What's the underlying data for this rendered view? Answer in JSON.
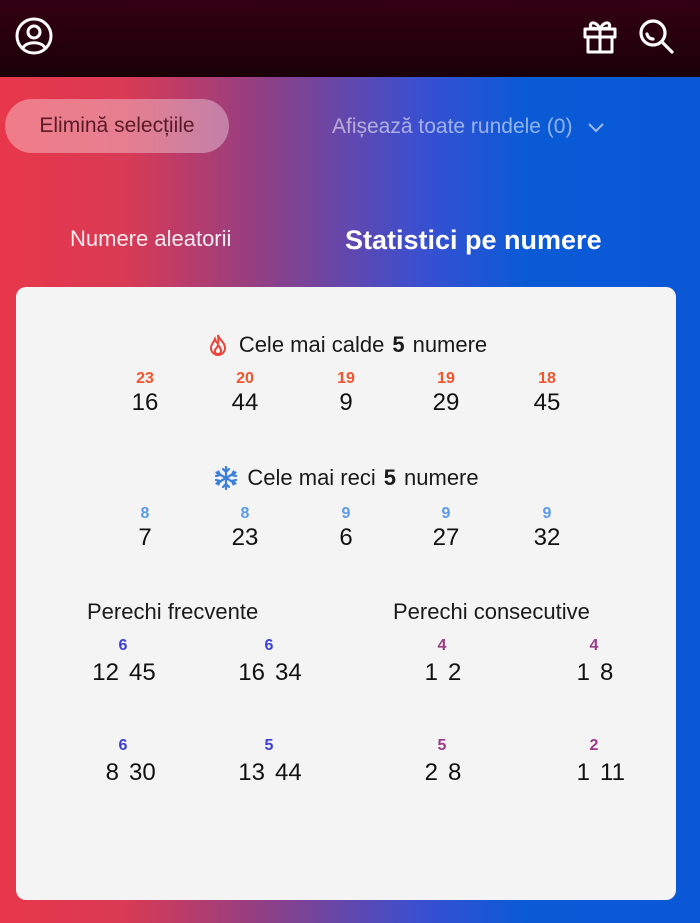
{
  "header": {
    "icons": [
      "account-icon",
      "gift-icon",
      "search-icon"
    ]
  },
  "toolbar": {
    "clear_label": "Elimină selecțiile",
    "rounds_label": "Afișează toate rundele (0)"
  },
  "tabs": [
    {
      "label": "Numere aleatorii",
      "active": false
    },
    {
      "label": "Statistici pe numere",
      "active": true
    }
  ],
  "hot": {
    "prefix": "Cele mai calde",
    "count": "5",
    "suffix": "numere",
    "items": [
      {
        "count": "23",
        "number": "16"
      },
      {
        "count": "20",
        "number": "44"
      },
      {
        "count": "19",
        "number": "9"
      },
      {
        "count": "19",
        "number": "29"
      },
      {
        "count": "18",
        "number": "45"
      }
    ]
  },
  "cold": {
    "prefix": "Cele mai reci",
    "count": "5",
    "suffix": "numere",
    "items": [
      {
        "count": "8",
        "number": "7"
      },
      {
        "count": "8",
        "number": "23"
      },
      {
        "count": "9",
        "number": "6"
      },
      {
        "count": "9",
        "number": "27"
      },
      {
        "count": "9",
        "number": "32"
      }
    ]
  },
  "frequent_pairs": {
    "title": "Perechi frecvente",
    "items": [
      {
        "a": "12",
        "b": "45",
        "count": "6"
      },
      {
        "a": "16",
        "b": "34",
        "count": "6"
      },
      {
        "a": "8",
        "b": "30",
        "count": "6"
      },
      {
        "a": "13",
        "b": "44",
        "count": "5"
      }
    ]
  },
  "consecutive_pairs": {
    "title": "Perechi consecutive",
    "items": [
      {
        "a": "1",
        "b": "2",
        "count": "4"
      },
      {
        "a": "1",
        "b": "8",
        "count": "4"
      },
      {
        "a": "2",
        "b": "8",
        "count": "5"
      },
      {
        "a": "1",
        "b": "11",
        "count": "2"
      }
    ]
  },
  "colors": {
    "hot": "#f2542c",
    "cold": "#5b9ae6",
    "frequent": "#3b3fd6",
    "consecutive": "#9b3a88"
  }
}
